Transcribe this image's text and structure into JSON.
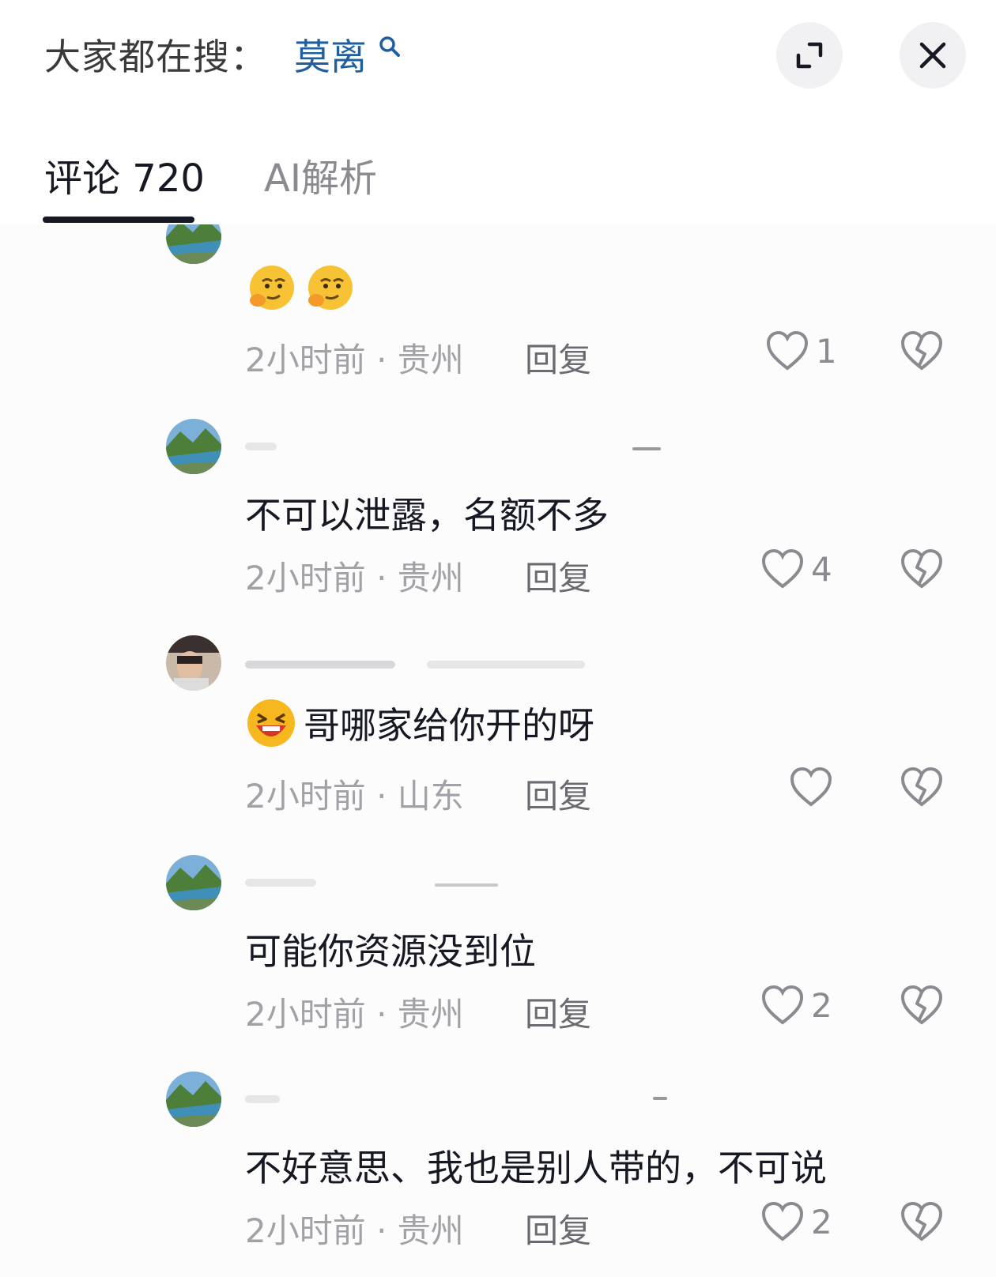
{
  "header": {
    "search_label": "大家都在搜：",
    "search_term": "莫离"
  },
  "tabs": {
    "comments_label": "评论",
    "comments_count": "720",
    "ai_label": "AI解析"
  },
  "comments": [
    {
      "text": "",
      "emojis": [
        "thinking-face",
        "thinking-face"
      ],
      "time": "2小时前",
      "location": "贵州",
      "reply": "回复",
      "likes": "1",
      "avatar": "landscape"
    },
    {
      "text": "不可以泄露，名额不多",
      "emojis": [],
      "time": "2小时前",
      "location": "贵州",
      "reply": "回复",
      "likes": "4",
      "avatar": "landscape"
    },
    {
      "text": "哥哪家给你开的呀",
      "emojis": [
        "laughing-face"
      ],
      "time": "2小时前",
      "location": "山东",
      "reply": "回复",
      "likes": "",
      "avatar": "person"
    },
    {
      "text": "可能你资源没到位",
      "emojis": [],
      "time": "2小时前",
      "location": "贵州",
      "reply": "回复",
      "likes": "2",
      "avatar": "landscape"
    },
    {
      "text": "不好意思、我也是别人带的，不可说",
      "emojis": [],
      "time": "2小时前",
      "location": "贵州",
      "reply": "回复",
      "likes": "2",
      "avatar": "landscape"
    }
  ],
  "meta_separator": " · ",
  "colors": {
    "search_term": "#1f5fa0",
    "text": "#161823",
    "muted": "#a1a2a7",
    "tab_active": "#161823"
  }
}
